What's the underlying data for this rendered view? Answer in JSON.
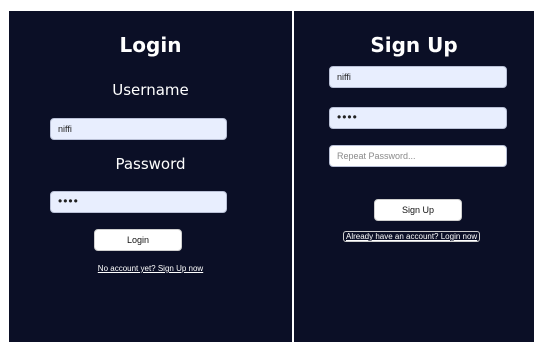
{
  "login": {
    "title": "Login",
    "username_label": "Username",
    "username_value": "niffi",
    "password_label": "Password",
    "password_value": "••••",
    "login_button": "Login",
    "signup_link": "No account yet? Sign Up now"
  },
  "signup": {
    "title": "Sign Up",
    "username_value": "niffi",
    "password_value": "••••",
    "repeat_password_placeholder": "Repeat Password...",
    "signup_button": "Sign Up",
    "login_link": "Already have an account? Login now"
  },
  "colors": {
    "panel_background": "#0b0f26",
    "input_background": "#e8eefe",
    "text": "#ffffff"
  }
}
